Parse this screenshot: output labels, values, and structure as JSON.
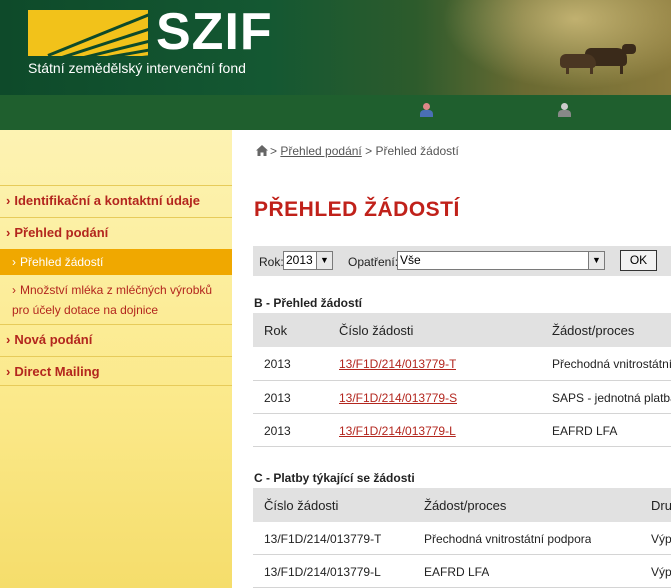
{
  "header": {
    "logo_text": "SZIF",
    "subtitle": "Státní zemědělský intervenční fond"
  },
  "sidebar": {
    "items": [
      {
        "label": "Identifikační a kontaktní údaje"
      },
      {
        "label": "Přehled podání"
      },
      {
        "label": "Nová podání"
      },
      {
        "label": "Direct Mailing"
      }
    ],
    "subitems": [
      {
        "label": "Přehled žádostí"
      },
      {
        "label": "Množství mléka z mléčných výrobků pro účely dotace na dojnice"
      }
    ]
  },
  "breadcrumb": {
    "link": "Přehled podání",
    "separator": ">",
    "current": "Přehled žádostí"
  },
  "page_title": "PŘEHLED ŽÁDOSTÍ",
  "filter": {
    "year_label": "Rok:",
    "year_value": "2013",
    "measure_label": "Opatření:",
    "measure_value": "Vše",
    "ok_label": "OK"
  },
  "section_b": {
    "title": "B - Přehled žádostí",
    "headers": [
      "Rok",
      "Číslo žádosti",
      "Žádost/proces"
    ],
    "rows": [
      {
        "year": "2013",
        "number": "13/F1D/214/013779-T",
        "process": "Přechodná vnitrostátní podpora"
      },
      {
        "year": "2013",
        "number": "13/F1D/214/013779-S",
        "process": "SAPS - jednotná platba na plochu"
      },
      {
        "year": "2013",
        "number": "13/F1D/214/013779-L",
        "process": "EAFRD LFA"
      }
    ]
  },
  "section_c": {
    "title": "C - Platby týkající se žádosti",
    "headers": [
      "Číslo žádosti",
      "Žádost/proces",
      "Druh"
    ],
    "rows": [
      {
        "number": "13/F1D/214/013779-T",
        "process": "Přechodná vnitrostátní podpora",
        "type": "Výplata"
      },
      {
        "number": "13/F1D/214/013779-L",
        "process": "EAFRD LFA",
        "type": "Výplata"
      }
    ]
  },
  "colors": {
    "header_green": "#145832",
    "nav_green": "#1f5f2e",
    "accent_red": "#c0211a",
    "sidebar_yellow": "#fbe98a",
    "active_orange": "#f0a800"
  }
}
